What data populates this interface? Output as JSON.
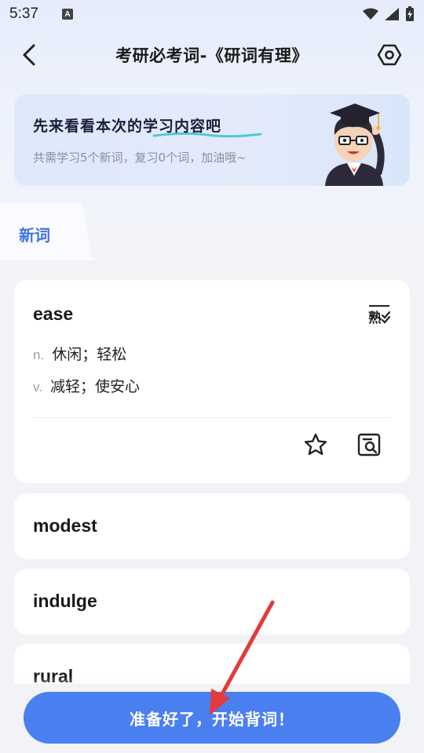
{
  "status_bar": {
    "time": "5:37",
    "icons": [
      "a-notification-icon",
      "wifi-icon",
      "signal-icon",
      "battery-icon"
    ]
  },
  "header": {
    "title": "考研必考词-《研词有理》",
    "back_icon": "back-chevron-icon",
    "settings_icon": "settings-hexagon-icon"
  },
  "banner": {
    "headline": "先来看看本次的学习内容吧",
    "subtitle": "共需学习5个新词，复习0个词，加油哦~",
    "mascot": "graduate-mascot"
  },
  "tabs": [
    {
      "label": "新词",
      "active": true
    }
  ],
  "words": [
    {
      "word": "ease",
      "definitions": [
        {
          "pos": "n.",
          "meaning": "休闲；轻松"
        },
        {
          "pos": "v.",
          "meaning": "减轻；使安心"
        }
      ],
      "known_icon": "熟",
      "actions": [
        "star-icon",
        "lookup-icon"
      ]
    },
    {
      "word": "modest"
    },
    {
      "word": "indulge"
    },
    {
      "word": "rural"
    }
  ],
  "cta": {
    "label": "准备好了，开始背词！"
  },
  "colors": {
    "accent": "#4a7ff0",
    "tab_active": "#3f72e8",
    "annotation_arrow": "#e23b3b"
  }
}
